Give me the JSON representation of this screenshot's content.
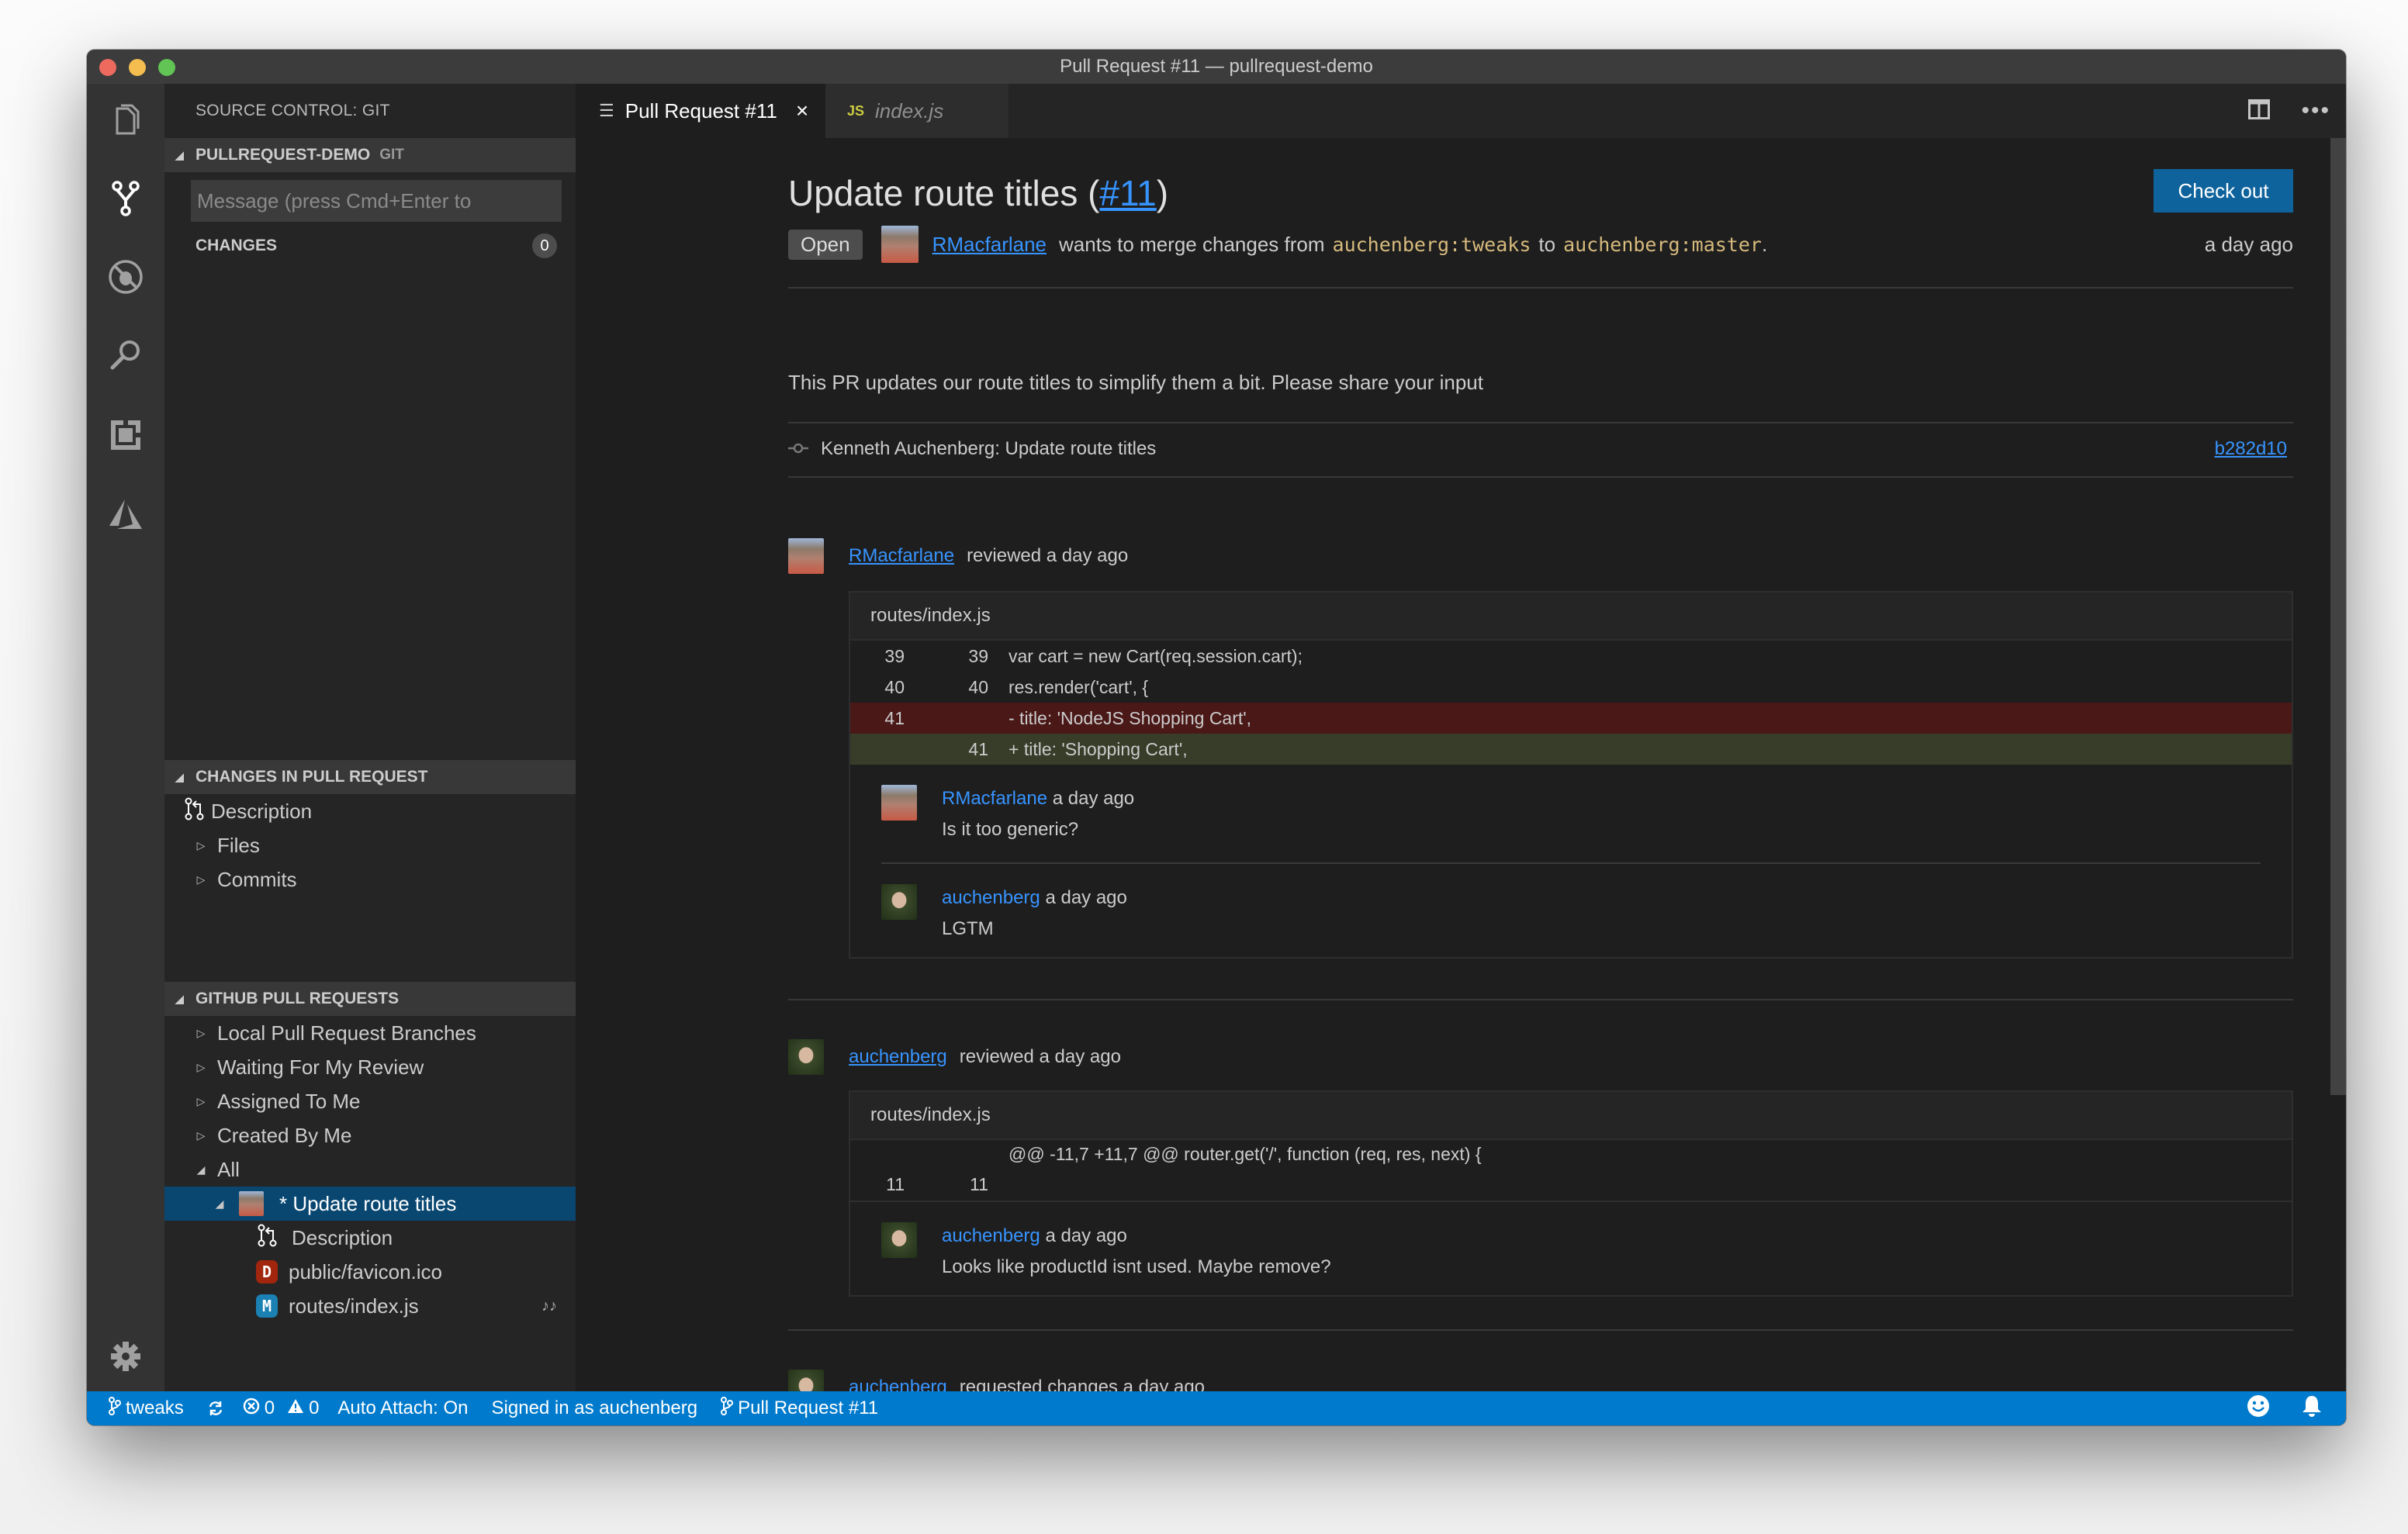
{
  "window": {
    "title": "Pull Request #11 — pullrequest-demo"
  },
  "activity_bar": {
    "items": [
      {
        "name": "explorer-icon",
        "label": "Explorer"
      },
      {
        "name": "source-control-icon",
        "label": "Source Control",
        "active": true
      },
      {
        "name": "debug-icon",
        "label": "Debug"
      },
      {
        "name": "search-icon",
        "label": "Search"
      },
      {
        "name": "extensions-icon",
        "label": "Extensions"
      },
      {
        "name": "azure-icon",
        "label": "Azure"
      }
    ],
    "settings_icon": "gear-icon"
  },
  "sidebar": {
    "title": "SOURCE CONTROL: GIT",
    "repo_section": {
      "name": "PULLREQUEST-DEMO",
      "sub": "GIT"
    },
    "commit_input": {
      "placeholder": "Message (press Cmd+Enter to commit)",
      "visible_text": "Message (press Cmd+Enter to",
      "value": ""
    },
    "changes": {
      "label": "CHANGES",
      "count": "0"
    },
    "changes_in_pr": {
      "header": "CHANGES IN PULL REQUEST",
      "items": [
        {
          "label": "Description",
          "icon": "pull-request-icon"
        },
        {
          "label": "Files",
          "expanded": false
        },
        {
          "label": "Commits",
          "expanded": false
        }
      ]
    },
    "github_prs": {
      "header": "GITHUB PULL REQUESTS",
      "categories": [
        {
          "label": "Local Pull Request Branches",
          "expanded": false
        },
        {
          "label": "Waiting For My Review",
          "expanded": false
        },
        {
          "label": "Assigned To Me",
          "expanded": false
        },
        {
          "label": "Created By Me",
          "expanded": false
        },
        {
          "label": "All",
          "expanded": true
        }
      ],
      "selected_pr": {
        "label": "* Update route titles",
        "expanded": true
      },
      "pr_children": [
        {
          "label": "Description",
          "icon": "pull-request-icon"
        },
        {
          "label": "public/favicon.ico",
          "status": "D",
          "status_color": "#a1260d"
        },
        {
          "label": "routes/index.js",
          "status": "M",
          "status_color": "#1b80b2",
          "comment_indicator": "♪♪"
        }
      ]
    }
  },
  "tabs": [
    {
      "label": "Pull Request #11",
      "icon": "preview-icon",
      "active": true,
      "close": "×"
    },
    {
      "label": "index.js",
      "icon_text": "JS",
      "icon_color": "#cbcb41",
      "active": false
    }
  ],
  "pr": {
    "title": "Update route titles (",
    "number": "#11",
    "title_close": ")",
    "checkout_label": "Check out",
    "status": "Open",
    "author": "RMacfarlane",
    "merge_text_1": "wants to merge changes from",
    "head_branch": "auchenberg:tweaks",
    "merge_text_2": "to",
    "base_branch": "auchenberg:master",
    "period": ".",
    "created": "a day ago",
    "description": "This PR updates our route titles to simplify them a bit. Please share your input",
    "commit": {
      "message": "Kenneth Auchenberg: Update route titles",
      "sha": "b282d10"
    },
    "timeline": [
      {
        "author": "RMacfarlane",
        "action": "reviewed a day ago",
        "file": "routes/index.js",
        "lines": [
          {
            "old": "39",
            "new": "39",
            "code": "var cart = new Cart(req.session.cart);",
            "type": "context"
          },
          {
            "old": "40",
            "new": "40",
            "code": "res.render('cart', {",
            "type": "context"
          },
          {
            "old": "41",
            "new": "",
            "code": "- title: 'NodeJS Shopping Cart',",
            "type": "del"
          },
          {
            "old": "",
            "new": "41",
            "code": "+ title: 'Shopping Cart',",
            "type": "add"
          }
        ],
        "comments": [
          {
            "author": "RMacfarlane",
            "time": "a day ago",
            "text": "Is it too generic?"
          },
          {
            "author": "auchenberg",
            "time": "a day ago",
            "text": "LGTM"
          }
        ]
      },
      {
        "author": "auchenberg",
        "action": "reviewed a day ago",
        "file": "routes/index.js",
        "hunk": "@@ -11,7 +11,7 @@ router.get('/', function (req, res, next) {",
        "lines": [
          {
            "old": "11",
            "new": "11",
            "code": "",
            "type": "context"
          }
        ],
        "comments": [
          {
            "author": "auchenberg",
            "time": "a day ago",
            "text": "Looks like productId isnt used. Maybe remove?"
          }
        ]
      },
      {
        "author": "auchenberg",
        "action": "requested changes a day ago"
      }
    ]
  },
  "statusbar": {
    "branch": "tweaks",
    "errors": "0",
    "warnings": "0",
    "auto_attach": "Auto Attach: On",
    "signed_in": "Signed in as auchenberg",
    "pr": "Pull Request #11"
  }
}
